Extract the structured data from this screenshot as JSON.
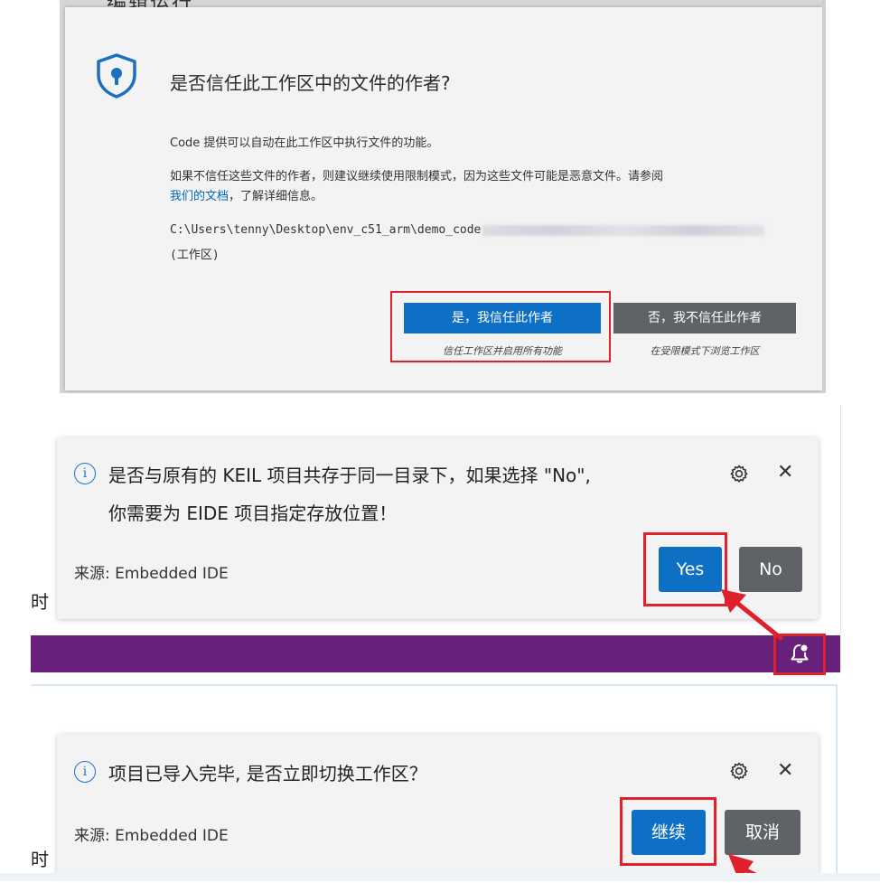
{
  "trust_dialog": {
    "top_cut_text": "编辑运行",
    "title": "是否信任此工作区中的文件的作者?",
    "line1": "Code 提供可以自动在此工作区中执行文件的功能。",
    "line2": "如果不信任这些文件的作者，则建议继续使用限制模式，因为这些文件可能是恶意文件。请参阅",
    "link": "我们的文档",
    "line3_rest": "，了解详细信息。",
    "path": "C:\\Users\\tenny\\Desktop\\env_c51_arm\\demo_code",
    "workspace_label": "(工作区)",
    "trust_button": "是，我信任此作者",
    "trust_sub": "信任工作区并启用所有功能",
    "untrust_button": "否，我不信任此作者",
    "untrust_sub": "在受限模式下浏览工作区"
  },
  "notification1": {
    "message_line1": "是否与原有的 KEIL 项目共存于同一目录下，如果选择 \"No\",",
    "message_line2": "你需要为 EIDE 项目指定存放位置！",
    "source": "来源: Embedded IDE",
    "yes": "Yes",
    "no": "No"
  },
  "notification2": {
    "message": "项目已导入完毕, 是否立即切换工作区？",
    "source": "来源: Embedded IDE",
    "continue": "继续",
    "cancel": "取消"
  },
  "background": {
    "text1": "时",
    "text2": "时"
  },
  "colors": {
    "primary_button": "#0e70c4",
    "secondary_button": "#5f6367",
    "status_bar": "#68217a",
    "highlight": "#e0202a",
    "info": "#1a73c9"
  },
  "icons": {
    "trust": "shield-keyhole-icon",
    "info": "info-icon",
    "settings": "gear-icon",
    "close": "close-icon",
    "notifications": "bell-icon"
  }
}
